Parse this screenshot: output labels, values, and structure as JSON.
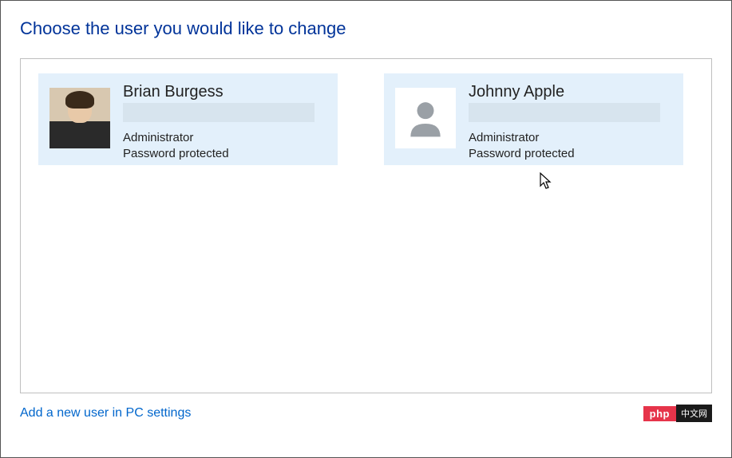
{
  "page": {
    "title": "Choose the user you would like to change"
  },
  "users": [
    {
      "name": "Brian Burgess",
      "role": "Administrator",
      "password_status": "Password protected",
      "avatar_type": "photo"
    },
    {
      "name": "Johnny Apple",
      "role": "Administrator",
      "password_status": "Password protected",
      "avatar_type": "generic"
    }
  ],
  "footer": {
    "add_user_link": "Add a new user in PC settings"
  },
  "badge": {
    "left": "php",
    "right": "中文网"
  }
}
